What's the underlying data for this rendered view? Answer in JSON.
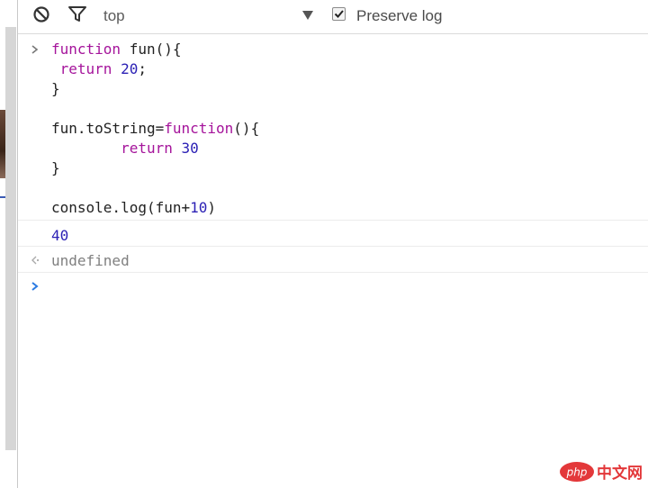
{
  "toolbar": {
    "clear_icon": "block-icon",
    "filter_icon": "filter-funnel-icon",
    "context": "top",
    "context_dropdown_icon": "triangle-down-icon",
    "preserve_log_label": "Preserve log",
    "preserve_log_checked": true
  },
  "console": {
    "input_lines": [
      [
        {
          "t": "kw",
          "v": "function"
        },
        {
          "t": "plain",
          "v": " fun(){"
        }
      ],
      [
        {
          "t": "kw",
          "v": " return"
        },
        {
          "t": "plain",
          "v": " "
        },
        {
          "t": "num",
          "v": "20"
        },
        {
          "t": "plain",
          "v": ";"
        }
      ],
      [
        {
          "t": "plain",
          "v": "}"
        }
      ],
      [
        {
          "t": "plain",
          "v": ""
        }
      ],
      [
        {
          "t": "plain",
          "v": "fun.toString="
        },
        {
          "t": "kw",
          "v": "function"
        },
        {
          "t": "plain",
          "v": "(){"
        }
      ],
      [
        {
          "t": "kw",
          "v": "        return"
        },
        {
          "t": "plain",
          "v": " "
        },
        {
          "t": "num",
          "v": "30"
        }
      ],
      [
        {
          "t": "plain",
          "v": "}"
        }
      ],
      [
        {
          "t": "plain",
          "v": ""
        }
      ],
      [
        {
          "t": "plain",
          "v": "console.log(fun+"
        },
        {
          "t": "num",
          "v": "10"
        },
        {
          "t": "plain",
          "v": ")"
        }
      ]
    ],
    "output_value": "40",
    "result_value": "undefined"
  },
  "watermark": {
    "logo_text": "php",
    "site_text": "中文网"
  },
  "colors": {
    "keyword": "#a5149b",
    "number": "#2c21b5",
    "prompt": "#2a7ae2"
  }
}
